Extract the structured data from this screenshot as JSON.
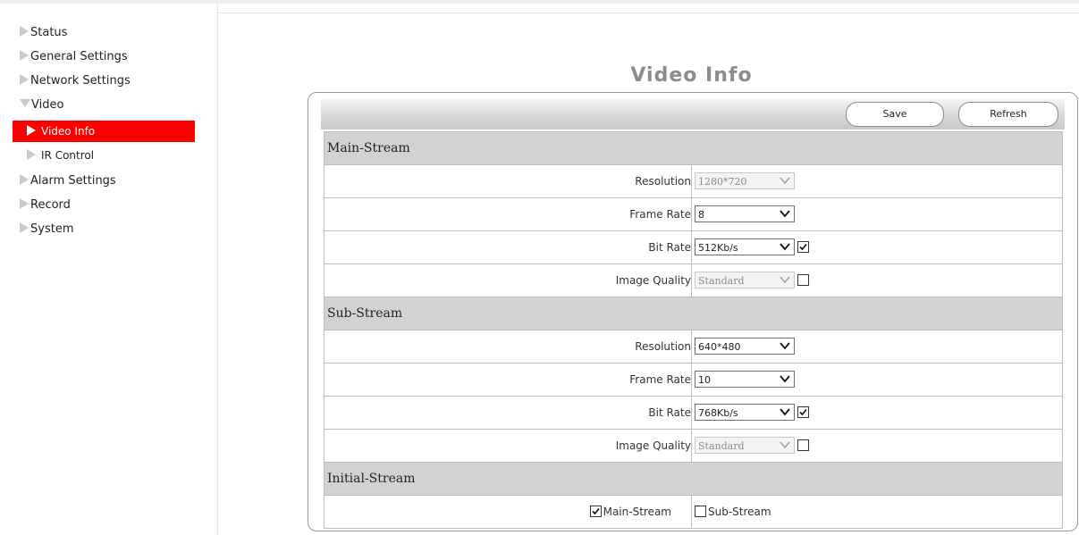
{
  "sidebar": {
    "items": [
      {
        "label": "Status"
      },
      {
        "label": "General Settings"
      },
      {
        "label": "Network Settings"
      },
      {
        "label": "Video"
      },
      {
        "label": "Alarm Settings"
      },
      {
        "label": "Record"
      },
      {
        "label": "System"
      }
    ],
    "video_subitems": [
      {
        "label": "Video Info",
        "active": true
      },
      {
        "label": "IR Control",
        "active": false
      }
    ],
    "active_color": "#ff0000"
  },
  "page": {
    "title": "Video Info",
    "save_label": "Save",
    "refresh_label": "Refresh"
  },
  "main_stream": {
    "heading": "Main-Stream",
    "resolution_label": "Resolution",
    "resolution_value": "1280*720",
    "frame_rate_label": "Frame Rate",
    "frame_rate_value": "8",
    "bit_rate_label": "Bit Rate",
    "bit_rate_value": "512Kb/s",
    "bit_rate_checked": true,
    "image_quality_label": "Image Quality",
    "image_quality_value": "Standard",
    "image_quality_checked": false
  },
  "sub_stream": {
    "heading": "Sub-Stream",
    "resolution_label": "Resolution",
    "resolution_value": "640*480",
    "frame_rate_label": "Frame Rate",
    "frame_rate_value": "10",
    "bit_rate_label": "Bit Rate",
    "bit_rate_value": "768Kb/s",
    "bit_rate_checked": true,
    "image_quality_label": "Image Quality",
    "image_quality_value": "Standard",
    "image_quality_checked": false
  },
  "initial_stream": {
    "heading": "Initial-Stream",
    "main_label": "Main-Stream",
    "main_checked": true,
    "sub_label": "Sub-Stream",
    "sub_checked": false
  }
}
